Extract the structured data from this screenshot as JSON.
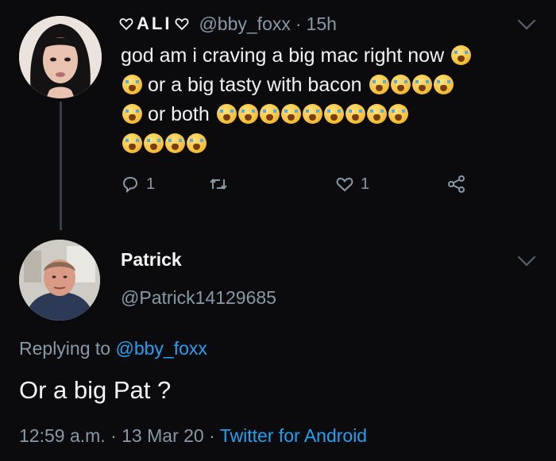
{
  "tweet": {
    "display_name": "ALI",
    "handle": "@bby_foxx",
    "separator": "·",
    "time": "15h",
    "line1": "god am i craving a big mac right now",
    "line2": "or a big tasty with bacon",
    "line3": "or both",
    "reply_count": "1",
    "like_count": "1"
  },
  "reply": {
    "name": "Patrick",
    "handle": "@Patrick14129685",
    "replying_prefix": "Replying to ",
    "replying_mention": "@bby_foxx",
    "text": "Or a big Pat ?",
    "time": "12:59 a.m.",
    "date": "13 Mar 20",
    "client": "Twitter for Android",
    "separator": " · "
  },
  "icons": {
    "name_decoration": "heart-outline-icon",
    "emoji": "loudly-crying-face-emoji"
  },
  "colors": {
    "background": "#0b0b0d",
    "link": "#1da1f2",
    "muted": "#8899a6",
    "text": "#f2f2f2"
  }
}
